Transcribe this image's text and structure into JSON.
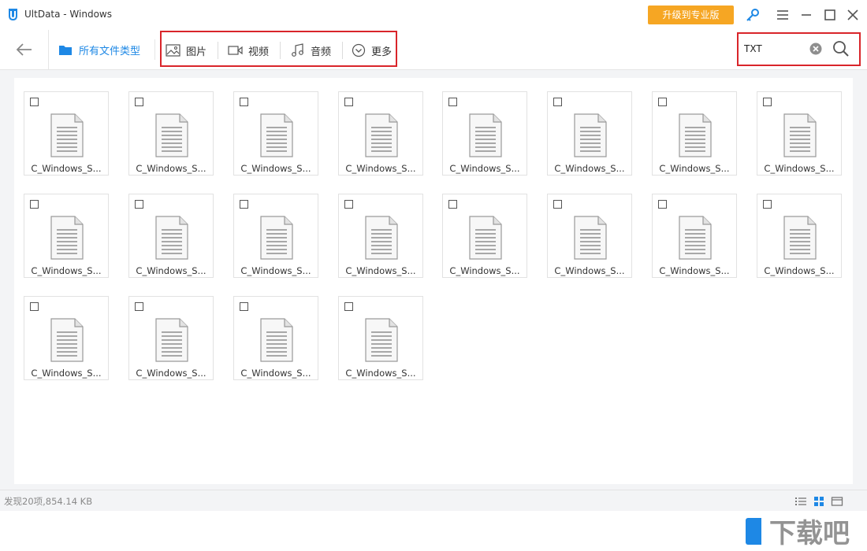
{
  "window": {
    "title": "UltData - Windows",
    "upgrade_label": "升级到专业版"
  },
  "toolbar": {
    "all_types_label": "所有文件类型",
    "categories": [
      {
        "label": "图片",
        "icon": "image-icon"
      },
      {
        "label": "视频",
        "icon": "video-icon"
      },
      {
        "label": "音频",
        "icon": "audio-icon"
      },
      {
        "label": "更多",
        "icon": "more-icon"
      }
    ]
  },
  "search": {
    "value": "TXT",
    "placeholder": ""
  },
  "files": [
    {
      "name": "C_Windows_S..."
    },
    {
      "name": "C_Windows_S..."
    },
    {
      "name": "C_Windows_S..."
    },
    {
      "name": "C_Windows_S..."
    },
    {
      "name": "C_Windows_S..."
    },
    {
      "name": "C_Windows_S..."
    },
    {
      "name": "C_Windows_S..."
    },
    {
      "name": "C_Windows_S..."
    },
    {
      "name": "C_Windows_S..."
    },
    {
      "name": "C_Windows_S..."
    },
    {
      "name": "C_Windows_S..."
    },
    {
      "name": "C_Windows_S..."
    },
    {
      "name": "C_Windows_S..."
    },
    {
      "name": "C_Windows_S..."
    },
    {
      "name": "C_Windows_S..."
    },
    {
      "name": "C_Windows_S..."
    },
    {
      "name": "C_Windows_S..."
    },
    {
      "name": "C_Windows_S..."
    },
    {
      "name": "C_Windows_S..."
    },
    {
      "name": "C_Windows_S..."
    }
  ],
  "status": {
    "summary": "发现20项,854.14 KB"
  },
  "colors": {
    "accent": "#1e88e5",
    "upgrade": "#f6a623",
    "highlight": "#d9252a"
  },
  "watermark_text": "下载吧"
}
